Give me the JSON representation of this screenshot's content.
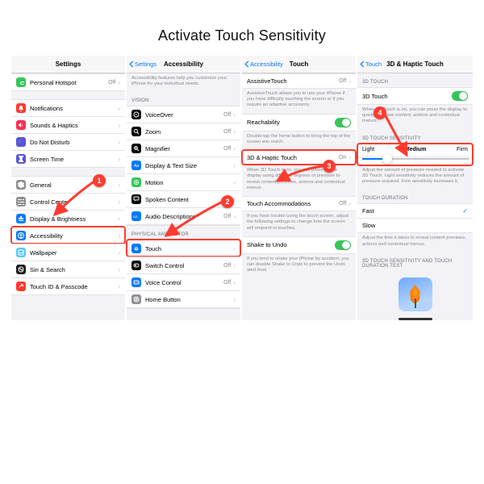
{
  "title": "Activate Touch Sensitivity",
  "panel1": {
    "header": "Settings",
    "items": [
      {
        "label": "Personal Hotspot",
        "value": "Off",
        "color": "#34c759",
        "glyph": "link"
      },
      {
        "label": "Notifications",
        "color": "#ff3b30",
        "glyph": "bell"
      },
      {
        "label": "Sounds & Haptics",
        "color": "#ff2d55",
        "glyph": "sound"
      },
      {
        "label": "Do Not Disturb",
        "color": "#5856d6",
        "glyph": "moon"
      },
      {
        "label": "Screen Time",
        "color": "#5856d6",
        "glyph": "hourglass"
      },
      {
        "label": "General",
        "color": "#8e8e93",
        "glyph": "gear"
      },
      {
        "label": "Control Center",
        "color": "#8e8e93",
        "glyph": "sliders"
      },
      {
        "label": "Display & Brightness",
        "color": "#007aff",
        "glyph": "display"
      },
      {
        "label": "Accessibility",
        "color": "#007aff",
        "glyph": "accessibility",
        "highlight": true
      },
      {
        "label": "Wallpaper",
        "color": "#5ac8fa",
        "glyph": "wallpaper"
      },
      {
        "label": "Siri & Search",
        "color": "#1e1e1e",
        "glyph": "siri"
      },
      {
        "label": "Touch ID & Passcode",
        "color": "#ff3b30",
        "glyph": "touchid"
      }
    ]
  },
  "panel2": {
    "back": "Settings",
    "header": "Accessibility",
    "intro": "Accessibility features help you customize your iPhone for your individual needs.",
    "sectionVision": "Vision",
    "vision": [
      {
        "label": "VoiceOver",
        "value": "Off",
        "color": "#000",
        "glyph": "voiceover"
      },
      {
        "label": "Zoom",
        "value": "Off",
        "color": "#000",
        "glyph": "zoom"
      },
      {
        "label": "Magnifier",
        "value": "Off",
        "color": "#000",
        "glyph": "magnifier"
      },
      {
        "label": "Display & Text Size",
        "color": "#007aff",
        "glyph": "textsize"
      },
      {
        "label": "Motion",
        "color": "#34c759",
        "glyph": "motion"
      },
      {
        "label": "Spoken Content",
        "color": "#000",
        "glyph": "speech"
      },
      {
        "label": "Audio Descriptions",
        "value": "Off",
        "color": "#007aff",
        "glyph": "audiodesc"
      }
    ],
    "sectionMotor": "Physical and Motor",
    "motor": [
      {
        "label": "Touch",
        "color": "#007aff",
        "glyph": "touch",
        "highlight": true
      },
      {
        "label": "Switch Control",
        "value": "Off",
        "color": "#000",
        "glyph": "switch"
      },
      {
        "label": "Voice Control",
        "value": "Off",
        "color": "#007aff",
        "glyph": "voicecontrol"
      },
      {
        "label": "Home Button",
        "color": "#8e8e93",
        "glyph": "home"
      }
    ]
  },
  "panel3": {
    "back": "Accessibility",
    "header": "Touch",
    "rows": {
      "assistive": "AssistiveTouch",
      "assistiveVal": "Off",
      "assistiveDesc": "AssistiveTouch allows you to use your iPhone if you have difficulty touching the screen or if you require an adaptive accessory.",
      "reach": "Reachability",
      "reachDesc": "Double-tap the home button to bring the top of the screen into reach.",
      "haptic": "3D & Haptic Touch",
      "hapticVal": "On",
      "hapticDesc": "When 3D Touch is on, you can press on the display using different degrees of pressure to reveal content previews, actions and contextual menus.",
      "accom": "Touch Accommodations",
      "accomVal": "Off",
      "accomDesc": "If you have trouble using the touch screen, adjust the following settings to change how the screen will respond to touches.",
      "shake": "Shake to Undo",
      "shakeDesc": "If you tend to shake your iPhone by accident, you can disable Shake to Undo to prevent the Undo alert from"
    }
  },
  "panel4": {
    "back": "Touch",
    "header": "3D & Haptic Touch",
    "section3d": "3D Touch",
    "row3d": "3D Touch",
    "desc3d": "When 3D Touch is on, you can press the display to quickly preview content, actions and contextual menus.",
    "sectionSens": "3D Touch Sensitivity",
    "sensLight": "Light",
    "sensMedium": "Medium",
    "sensFirm": "Firm",
    "sensDesc": "Adjust the amount of pressure needed to activate 3D Touch. Light sensitivity reduces the amount of pressure required. Firm sensitivity increases it.",
    "sectionDur": "Touch Duration",
    "fast": "Fast",
    "slow": "Slow",
    "durDesc": "Adjust the time it takes to reveal content previews, actions and contextual menus.",
    "sectionTest": "3D Touch Sensitivity and Touch Duration Test"
  },
  "badges": {
    "b1": "1",
    "b2": "2",
    "b3": "3",
    "b4": "4"
  }
}
